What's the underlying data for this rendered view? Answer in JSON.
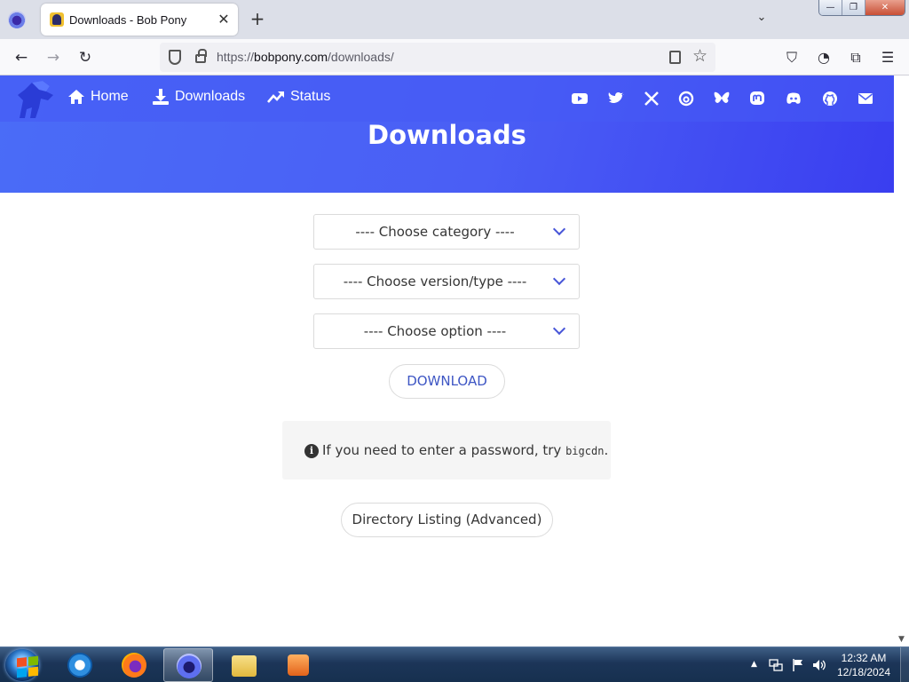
{
  "browser": {
    "tab": {
      "title": "Downloads - Bob Pony",
      "close_glyph": "✕"
    },
    "new_tab_glyph": "+",
    "tab_list_glyph": "⌄",
    "window_buttons": {
      "minimize": "—",
      "restore": "❐",
      "close": "✕"
    },
    "nav": {
      "back": "←",
      "forward": "→",
      "reload": "↻"
    },
    "url": {
      "prefix": "https://",
      "host": "bobpony.com",
      "path": "/downloads/"
    },
    "star_glyph": "☆",
    "toolbar": {
      "pocket": "⛉",
      "account": "◔",
      "extensions": "⧉",
      "menu": "☰"
    }
  },
  "site": {
    "nav_links": [
      {
        "label": "Home",
        "icon": "home-icon"
      },
      {
        "label": "Downloads",
        "icon": "download-icon"
      },
      {
        "label": "Status",
        "icon": "trending-up-icon"
      }
    ],
    "social_icons": [
      "youtube-icon",
      "twitter-icon",
      "x-icon",
      "threads-icon",
      "bluesky-icon",
      "mastodon-icon",
      "discord-icon",
      "github-icon",
      "email-icon"
    ],
    "page_title": "Downloads"
  },
  "form": {
    "category_select": "---- Choose category ----",
    "version_select": "---- Choose version/type ----",
    "option_select": "---- Choose option ----",
    "download_button": "DOWNLOAD"
  },
  "notice": {
    "info_glyph": "i",
    "text_before": "If you need to enter a password, try ",
    "code": "bigcdn",
    "text_after": "."
  },
  "directory_button": "Directory Listing (Advanced)",
  "scrollbar": {
    "down_glyph": "▼"
  },
  "taskbar": {
    "items": [
      "internet-explorer-icon",
      "firefox-icon",
      "firefox-nightly-icon",
      "file-explorer-icon",
      "media-player-icon"
    ],
    "active_item": "firefox-nightly-icon",
    "tray": {
      "expand": "▲"
    },
    "time": "12:32 AM",
    "date": "12/18/2024"
  },
  "colors": {
    "header_start": "#4a6cf7",
    "header_end": "#3a3ef0",
    "link_blue": "#3e56c4"
  }
}
